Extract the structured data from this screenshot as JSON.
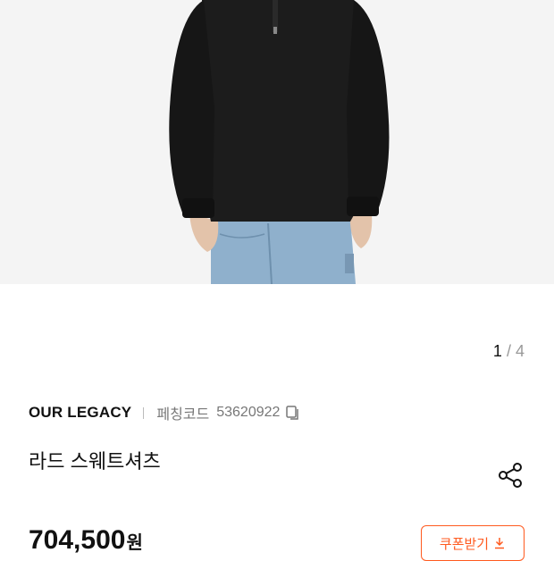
{
  "gallery": {
    "current": "1",
    "separator": "/",
    "total": "4"
  },
  "product": {
    "brand": "OUR LEGACY",
    "code_label": "페칭코드",
    "code_value": "53620922",
    "title": "라드 스웨트셔츠",
    "price": "704,500",
    "currency": "원"
  },
  "actions": {
    "coupon_label": "쿠폰받기"
  },
  "colors": {
    "accent": "#ff5a1f",
    "text": "#111111",
    "muted": "#777777"
  },
  "icons": {
    "copy": "copy-icon",
    "share": "share-icon",
    "download": "download-icon"
  }
}
